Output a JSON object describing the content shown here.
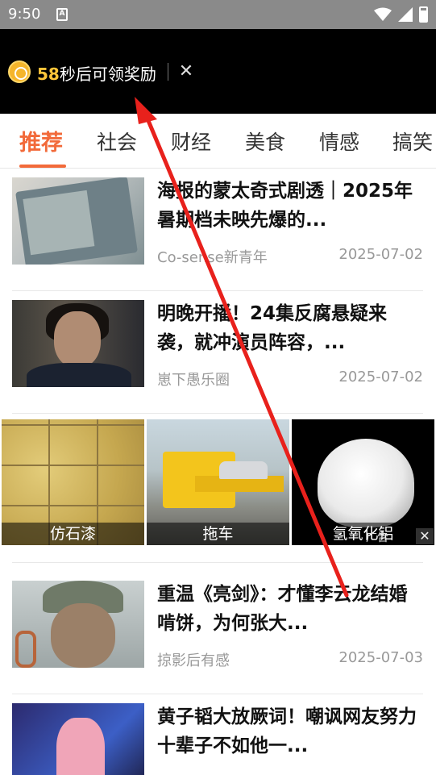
{
  "status_bar": {
    "time": "9:50",
    "notification_icon": "A"
  },
  "reward_bar": {
    "seconds": "58",
    "text": "秒后可领奖励"
  },
  "tabs": [
    {
      "label": "推荐",
      "active": true
    },
    {
      "label": "社会",
      "active": false
    },
    {
      "label": "财经",
      "active": false
    },
    {
      "label": "美食",
      "active": false
    },
    {
      "label": "情感",
      "active": false
    },
    {
      "label": "搞笑",
      "active": false
    }
  ],
  "feed": [
    {
      "title": "海报的蒙太奇式剧透｜2025年暑期档未映先爆的...",
      "source": "Co-sense新青年",
      "date": "2025-07-02",
      "thumb": "poster"
    },
    {
      "title": "明晚开播！24集反腐悬疑来袭，就冲演员阵容，...",
      "source": "崽下愚乐圈",
      "date": "2025-07-02",
      "thumb": "woman"
    },
    {
      "title": "重温《亮剑》：才懂李云龙结婚啃饼，为何张大...",
      "source": "掠影后有感",
      "date": "2025-07-03",
      "thumb": "soldier"
    },
    {
      "title": "黄子韬大放厥词！嘲讽网友努力十辈子不如他一...",
      "source": "",
      "date": "",
      "thumb": "singer"
    }
  ],
  "ad_strip": {
    "items": [
      {
        "caption": "仿石漆"
      },
      {
        "caption": "拖车"
      },
      {
        "caption": "氢氧化铝"
      }
    ],
    "badge": "广告",
    "close": "✕"
  },
  "colors": {
    "accent": "#f26a3a",
    "reward_seconds": "#ffc63a",
    "annotation": "#e8211c"
  }
}
